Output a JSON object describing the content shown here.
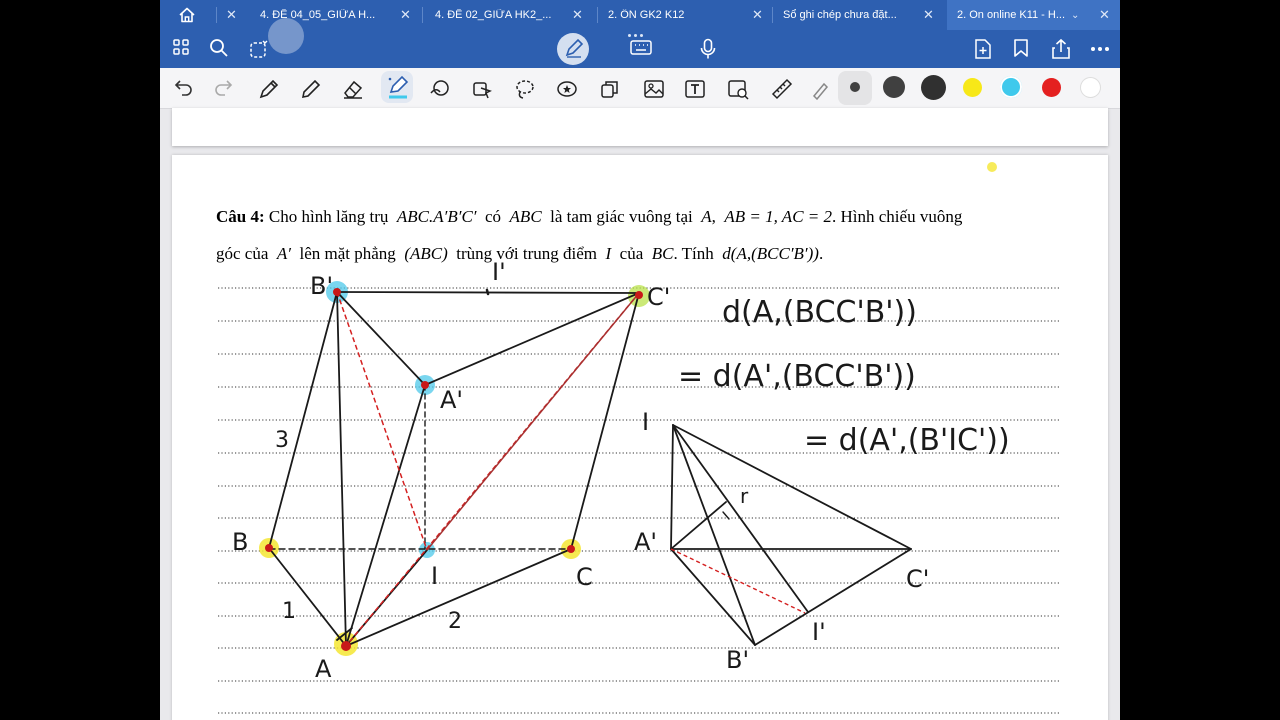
{
  "tabs": [
    {
      "label": "4. ĐỀ 04_05_GIỮA H..."
    },
    {
      "label": "4. ĐỀ 02_GIỮA HK2_..."
    },
    {
      "label": "2. ÔN GK2 K12"
    },
    {
      "label": "Sổ ghi chép chưa đặt..."
    },
    {
      "label": "2. On online K11 - H..."
    }
  ],
  "colors": {
    "tabbar": "#2d5fb0",
    "toolbar": "#f5f5f7",
    "ink_black": "#1a1a1a",
    "ink_red": "#d42020",
    "highlight_yellow": "#f5e632",
    "highlight_cyan": "#4ec8ea"
  },
  "toolbar_top": {
    "icons": [
      "grid-icon",
      "search-icon",
      "lasso-select-icon",
      "pen-mode-icon",
      "keyboard-icon",
      "microphone-icon",
      "add-page-icon",
      "bookmark-icon",
      "share-icon",
      "more-icon"
    ]
  },
  "toolbar_tools": {
    "icons": [
      "undo-icon",
      "redo-icon",
      "pen-icon",
      "pencil-icon",
      "eraser-icon",
      "highlighter-icon",
      "shapes-icon",
      "elements-icon",
      "lasso-icon",
      "sticker-icon",
      "copy-icon",
      "image-icon",
      "text-icon",
      "screenshot-icon",
      "ruler-icon",
      "laser-icon"
    ],
    "color_swatches": [
      "#404040",
      "#404040",
      "#303030",
      "#f7e818",
      "#3fc9ec",
      "#e42020",
      "#ffffff"
    ]
  },
  "document": {
    "problem_label": "Câu 4:",
    "problem_line1_text": "Cho hình lăng trụ",
    "prism_name": "ABC.A′B′C′",
    "co": "có",
    "tri": "ABC",
    "la_tam_giac": "là tam giác vuông tại",
    "vertexA": "A",
    "lengths": "AB = 1, AC = 2",
    "hinh_chieu": ". Hình chiếu vuông",
    "line2_a": "góc của",
    "Aprime": "A′",
    "line2_b": "lên mặt phẳng",
    "plane": "(ABC)",
    "line2_c": "trùng với trung điểm",
    "I": "I",
    "line2_d": "của",
    "BC": "BC",
    "line2_e": ". Tính",
    "ask": "d(A,(BCC′B′))",
    "period": "."
  },
  "handwriting": {
    "labels": [
      "B'",
      "I'",
      "C'",
      "A'",
      "3",
      "B",
      "I",
      "C",
      "1",
      "2",
      "A",
      "I",
      "r",
      "A'",
      "C'",
      "I'",
      "B'"
    ],
    "eq1": "d(A,(BCC'B'))",
    "eq2": "= d(A',(BCC'B'))",
    "eq3": "= d(A',(B'IC'))"
  }
}
